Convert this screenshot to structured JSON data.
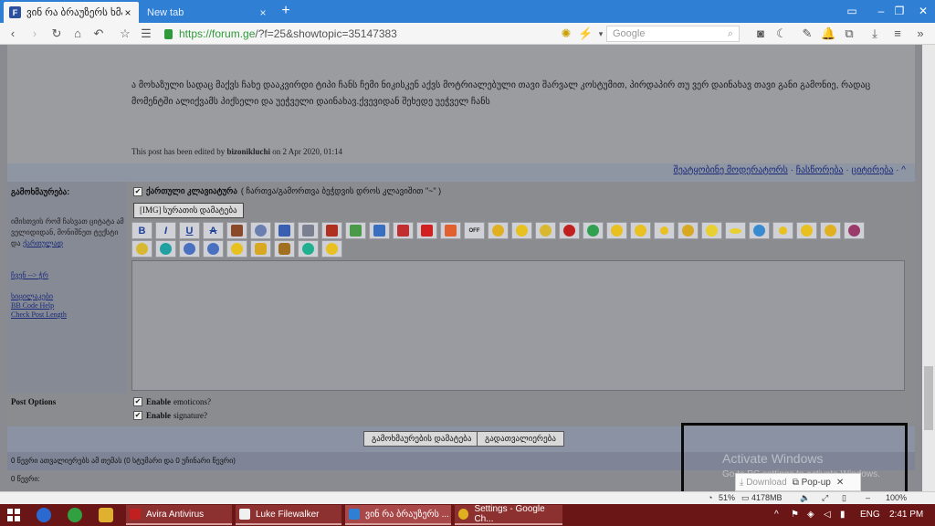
{
  "browser": {
    "tabs": [
      {
        "label": "ვინ რა ბრაუზერს ხმარ",
        "active": true
      },
      {
        "label": "New tab",
        "active": false
      }
    ],
    "url_prefix": "https://forum.ge",
    "url_rest": "/?f=25&showtopic=35147383",
    "search_placeholder": "Google"
  },
  "post": {
    "text": "ა მოხაზული სადაც მაქვს ჩახე დააკვირდი ტიპი ჩანს ჩემი ნიკისკენ აქვს მოტრიალებული თავი შარვალ კოსტუმით, პირდაპირ თუ ვერ დაინახავ თავი განი გამონიე, რადაც მომენტში ალიქვამს პიქსელი და უეჭველი დაინახავ.ქვევიდან შეხედე უეჭველ ჩანს",
    "edited_prefix": "This post has been edited by ",
    "edited_user": "bizonikluchi",
    "edited_suffix": " on 2 Apr 2020, 01:14",
    "links": [
      "შეატყობინე მოდერატორს",
      "ჩასწორება",
      "ციტირება"
    ]
  },
  "reply": {
    "title": "გამოხმაურება:",
    "note_text": "იმისთვის რომ ჩასვათ ციტატა ამ ველიდიდან, მონიშნეთ ტექსტი და ",
    "note_link": "ქართულად",
    "links": [
      "ჩვენ --> ჭრ",
      "სიცილაკები",
      "BB Code Help",
      "Check Post Length"
    ],
    "keyboard_label": "ქართული კლავიატურა",
    "keyboard_hint": "( ჩართვა/გამორთვა ბეჭდვის დროს კლავიშით \"~\" )",
    "img_button": "[IMG] სურათის დამატება",
    "format_buttons": [
      "B",
      "I",
      "U",
      "A"
    ]
  },
  "post_options": {
    "title": "Post Options",
    "emoticons": "Enable",
    "emoticons_suffix": "emoticons?",
    "signature": "Enable",
    "signature_suffix": "signature?"
  },
  "buttons": {
    "add_reply": "გამოხმაურების დამატება",
    "preview": "გადათვალიერება"
  },
  "stats": {
    "reading": "0 წევრი ათვალიერებს ამ თემას (0 სტუმარი და 0 უჩინარი წევრი)",
    "members": "0 წევრი:"
  },
  "overlay": {
    "watermark_title": "Activate Windows",
    "watermark_sub": "Go to PC settings to activate Windows.",
    "popup_download": "Download",
    "popup_label": "Pop-up"
  },
  "statusbar": {
    "cpu": "51%",
    "memory": "4178MB",
    "zoom": "100%"
  },
  "taskbar": {
    "tasks": [
      "Avira Antivirus",
      "Luke Filewalker",
      "ვინ რა ბრაუზერს ...",
      "Settings - Google Ch..."
    ],
    "lang": "ENG",
    "time": "2:41 PM"
  },
  "colors": {
    "tab_bar": "#2f7fd4",
    "page_bg": "#898b91",
    "taskbar": "#6b1616"
  }
}
